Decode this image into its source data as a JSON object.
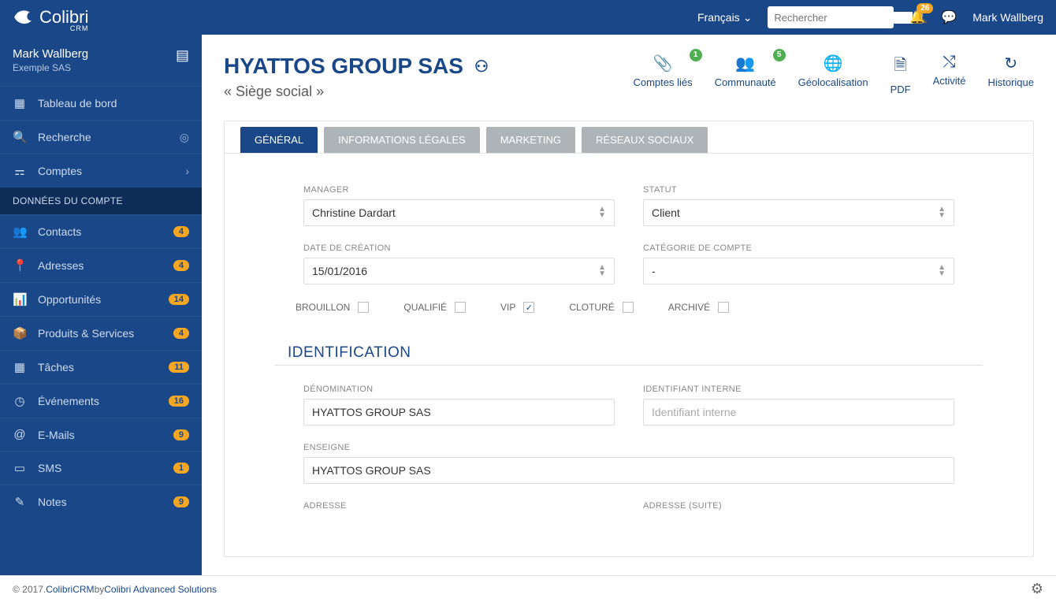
{
  "header": {
    "logo": "Colibri",
    "logo_sub": "CRM",
    "language": "Français",
    "search_placeholder": "Rechercher",
    "notif_count": "26",
    "user": "Mark Wallberg"
  },
  "sidebar": {
    "user_name": "Mark Wallberg",
    "user_company": "Exemple SAS",
    "nav1": [
      {
        "icon": "dashboard",
        "label": "Tableau de bord"
      },
      {
        "icon": "search",
        "label": "Recherche",
        "end": "target"
      },
      {
        "icon": "share",
        "label": "Comptes",
        "end": "chevron"
      }
    ],
    "section": "DONNÉES DU COMPTE",
    "nav2": [
      {
        "icon": "users",
        "label": "Contacts",
        "count": "4"
      },
      {
        "icon": "pin",
        "label": "Adresses",
        "count": "4"
      },
      {
        "icon": "chart",
        "label": "Opportunités",
        "count": "14"
      },
      {
        "icon": "cube",
        "label": "Produits & Services",
        "count": "4"
      },
      {
        "icon": "calendar",
        "label": "Tâches",
        "count": "11"
      },
      {
        "icon": "clock",
        "label": "Événements",
        "count": "16"
      },
      {
        "icon": "at",
        "label": "E-Mails",
        "count": "9"
      },
      {
        "icon": "phone",
        "label": "SMS",
        "count": "1"
      },
      {
        "icon": "note",
        "label": "Notes",
        "count": "9"
      }
    ]
  },
  "page": {
    "title": "HYATTOS GROUP SAS",
    "subtitle": "« Siège social »",
    "actions": [
      {
        "icon": "clip",
        "label": "Comptes liés",
        "badge": "1"
      },
      {
        "icon": "group",
        "label": "Communauté",
        "badge": "5"
      },
      {
        "icon": "globe",
        "label": "Géolocalisation"
      },
      {
        "icon": "pdf",
        "label": "PDF"
      },
      {
        "icon": "shuffle",
        "label": "Activité"
      },
      {
        "icon": "history",
        "label": "Historique"
      }
    ]
  },
  "tabs": [
    {
      "label": "GÉNÉRAL",
      "active": true
    },
    {
      "label": "INFORMATIONS LÉGALES"
    },
    {
      "label": "MARKETING"
    },
    {
      "label": "RÉSEAUX SOCIAUX"
    }
  ],
  "form": {
    "manager": {
      "label": "MANAGER",
      "value": "Christine Dardart"
    },
    "statut": {
      "label": "STATUT",
      "value": "Client"
    },
    "date": {
      "label": "DATE DE CRÉATION",
      "value": "15/01/2016"
    },
    "categorie": {
      "label": "CATÉGORIE DE COMPTE",
      "value": "-"
    },
    "checks": [
      {
        "label": "BROUILLON",
        "checked": false
      },
      {
        "label": "QUALIFIÉ",
        "checked": false
      },
      {
        "label": "VIP",
        "checked": true
      },
      {
        "label": "CLOTURÉ",
        "checked": false
      },
      {
        "label": "ARCHIVÉ",
        "checked": false
      }
    ],
    "section_ident": "IDENTIFICATION",
    "denom": {
      "label": "DÉNOMINATION",
      "value": "HYATTOS GROUP SAS"
    },
    "ident_int": {
      "label": "IDENTIFIANT INTERNE",
      "placeholder": "Identifiant interne"
    },
    "enseigne": {
      "label": "ENSEIGNE",
      "value": "HYATTOS GROUP SAS"
    },
    "adresse": {
      "label": "ADRESSE"
    },
    "adresse_suite": {
      "label": "ADRESSE (SUITE)"
    }
  },
  "footer": {
    "copyright": "© 2017. ",
    "brand": "ColibriCRM",
    "by": " by ",
    "company": "Colibri Advanced Solutions"
  }
}
